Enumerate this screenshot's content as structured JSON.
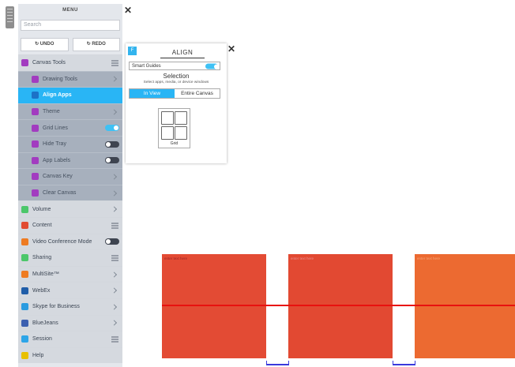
{
  "menu": {
    "title": "MENU",
    "search_placeholder": "Search",
    "undo_label": "UNDO",
    "redo_label": "REDO",
    "items": [
      {
        "label": "Canvas Tools",
        "accent": "#a23cc0",
        "control": "list"
      },
      {
        "label": "Drawing Tools",
        "accent": "#a23cc0",
        "control": "chevron"
      },
      {
        "label": "Align Apps",
        "accent": "#a23cc0",
        "control": "none"
      },
      {
        "label": "Theme",
        "accent": "#a23cc0",
        "control": "chevron"
      },
      {
        "label": "Grid Lines",
        "accent": "#a23cc0",
        "control": "toggle",
        "on": true
      },
      {
        "label": "Hide Tray",
        "accent": "#a23cc0",
        "control": "toggle",
        "on": false
      },
      {
        "label": "App Labels",
        "accent": "#a23cc0",
        "control": "toggle",
        "on": false
      },
      {
        "label": "Canvas Key",
        "accent": "#a23cc0",
        "control": "chevron"
      },
      {
        "label": "Clear Canvas",
        "accent": "#a23cc0",
        "control": "chevron"
      },
      {
        "label": "Volume",
        "accent": "#4cc76a",
        "control": "chevron"
      },
      {
        "label": "Content",
        "accent": "#e14b32",
        "control": "list"
      },
      {
        "label": "Video Conference Mode",
        "accent": "#ee7b22",
        "control": "toggle",
        "on": false
      },
      {
        "label": "Sharing",
        "accent": "#4cc76a",
        "control": "list"
      },
      {
        "label": "MultiSite™",
        "accent": "#ee7b22",
        "control": "chevron"
      },
      {
        "label": "WebEx",
        "accent": "#1f5da8",
        "control": "chevron"
      },
      {
        "label": "Skype for Business",
        "accent": "#2a9be0",
        "control": "chevron"
      },
      {
        "label": "BlueJeans",
        "accent": "#3b5fb0",
        "control": "chevron"
      },
      {
        "label": "Session",
        "accent": "#2da5e8",
        "control": "list"
      },
      {
        "label": "Help",
        "accent": "#e8c000",
        "control": "none"
      }
    ]
  },
  "align": {
    "logo": "F",
    "title": "ALIGN",
    "smart_guides_label": "Smart Guides",
    "smart_guides_on": true,
    "selection_title": "Selection",
    "selection_hint": "Select apps, media, or device windows",
    "tabs": [
      "In View",
      "Entire Canvas"
    ],
    "active_tab": "In View",
    "grid_label": "Grid"
  },
  "canvas": {
    "tiles": [
      {
        "placeholder": "enter text here",
        "color": "#e34b34",
        "text_color": "#9c2226"
      },
      {
        "placeholder": "enter text here",
        "color": "#e24932",
        "text_color": "#ea8f8f"
      },
      {
        "placeholder": "enter text here",
        "color": "#ec6a31",
        "text_color": "#f5a578"
      }
    ],
    "guide_color": "#e8110f",
    "spacing_color": "#3a3adc"
  },
  "icons": {
    "close": "close-icon",
    "undo": "undo-icon",
    "redo": "redo-icon"
  }
}
